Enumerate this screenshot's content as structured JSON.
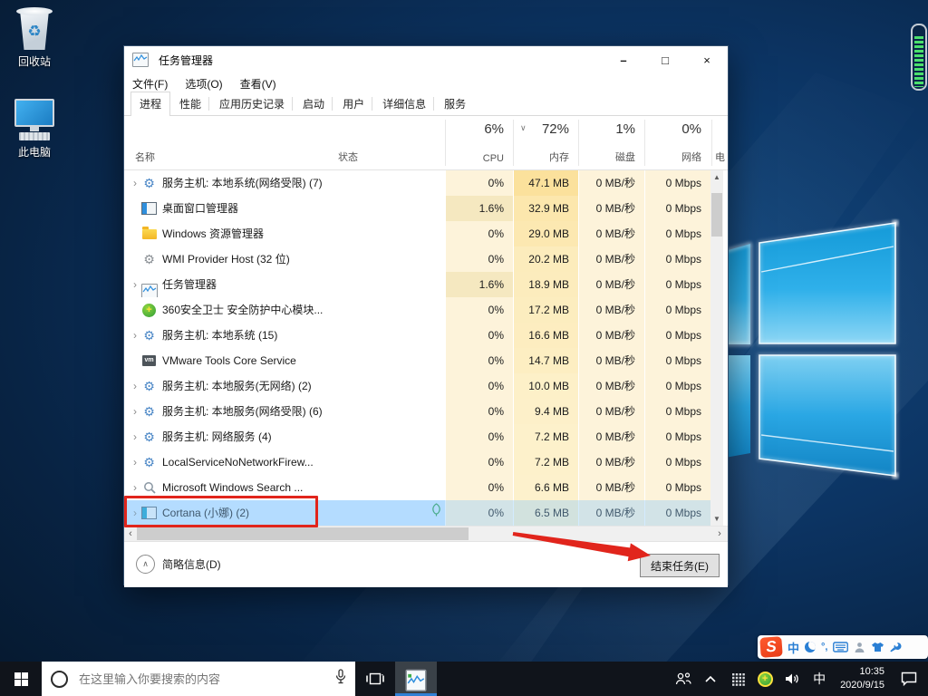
{
  "desktop": {
    "icons": [
      {
        "label": "回收站",
        "icon": "recycle-bin"
      },
      {
        "label": "此电脑",
        "icon": "this-pc"
      }
    ]
  },
  "taskmgr": {
    "title": "任务管理器",
    "menus": [
      "文件(F)",
      "选项(O)",
      "查看(V)"
    ],
    "window_controls": [
      {
        "name": "minimize",
        "glyph": "–"
      },
      {
        "name": "maximize",
        "glyph": "□"
      },
      {
        "name": "close",
        "glyph": "×"
      }
    ],
    "tabs": [
      {
        "label": "进程",
        "active": true
      },
      {
        "label": "性能",
        "active": false
      },
      {
        "label": "应用历史记录",
        "active": false
      },
      {
        "label": "启动",
        "active": false
      },
      {
        "label": "用户",
        "active": false
      },
      {
        "label": "详细信息",
        "active": false
      },
      {
        "label": "服务",
        "active": false
      }
    ],
    "columns": {
      "name": "名称",
      "status": "状态",
      "cpu": {
        "value": "6%",
        "label": "CPU"
      },
      "mem": {
        "value": "72%",
        "label": "内存",
        "sort_glyph": "∨"
      },
      "disk": {
        "value": "1%",
        "label": "磁盘"
      },
      "net": {
        "value": "0%",
        "label": "网络"
      },
      "power_clipped": "电"
    },
    "rows": [
      {
        "expand": true,
        "icon": "gear",
        "name": "服务主机: 本地系统(网络受限) (7)",
        "status": "",
        "cpu": "0%",
        "mem": "47.1 MB",
        "mem_mb": 47.1,
        "disk": "0 MB/秒",
        "net": "0 Mbps"
      },
      {
        "expand": false,
        "icon": "window",
        "name": "桌面窗口管理器",
        "status": "",
        "cpu": "1.6%",
        "mem": "32.9 MB",
        "mem_mb": 32.9,
        "disk": "0 MB/秒",
        "net": "0 Mbps"
      },
      {
        "expand": false,
        "icon": "folder",
        "name": "Windows 资源管理器",
        "status": "",
        "cpu": "0%",
        "mem": "29.0 MB",
        "mem_mb": 29.0,
        "disk": "0 MB/秒",
        "net": "0 Mbps"
      },
      {
        "expand": false,
        "icon": "wmi",
        "name": "WMI Provider Host (32 位)",
        "status": "",
        "cpu": "0%",
        "mem": "20.2 MB",
        "mem_mb": 20.2,
        "disk": "0 MB/秒",
        "net": "0 Mbps"
      },
      {
        "expand": true,
        "icon": "taskmgr",
        "name": "任务管理器",
        "status": "",
        "cpu": "1.6%",
        "mem": "18.9 MB",
        "mem_mb": 18.9,
        "disk": "0 MB/秒",
        "net": "0 Mbps"
      },
      {
        "expand": false,
        "icon": "s360",
        "name": "360安全卫士 安全防护中心模块...",
        "status": "",
        "cpu": "0%",
        "mem": "17.2 MB",
        "mem_mb": 17.2,
        "disk": "0 MB/秒",
        "net": "0 Mbps"
      },
      {
        "expand": true,
        "icon": "gear",
        "name": "服务主机: 本地系统 (15)",
        "status": "",
        "cpu": "0%",
        "mem": "16.6 MB",
        "mem_mb": 16.6,
        "disk": "0 MB/秒",
        "net": "0 Mbps"
      },
      {
        "expand": false,
        "icon": "vm",
        "name": "VMware Tools Core Service",
        "status": "",
        "cpu": "0%",
        "mem": "14.7 MB",
        "mem_mb": 14.7,
        "disk": "0 MB/秒",
        "net": "0 Mbps"
      },
      {
        "expand": true,
        "icon": "gear",
        "name": "服务主机: 本地服务(无网络) (2)",
        "status": "",
        "cpu": "0%",
        "mem": "10.0 MB",
        "mem_mb": 10.0,
        "disk": "0 MB/秒",
        "net": "0 Mbps"
      },
      {
        "expand": true,
        "icon": "gear",
        "name": "服务主机: 本地服务(网络受限) (6)",
        "status": "",
        "cpu": "0%",
        "mem": "9.4 MB",
        "mem_mb": 9.4,
        "disk": "0 MB/秒",
        "net": "0 Mbps"
      },
      {
        "expand": true,
        "icon": "gear",
        "name": "服务主机: 网络服务 (4)",
        "status": "",
        "cpu": "0%",
        "mem": "7.2 MB",
        "mem_mb": 7.2,
        "disk": "0 MB/秒",
        "net": "0 Mbps"
      },
      {
        "expand": true,
        "icon": "gear",
        "name": "LocalServiceNoNetworkFirew...",
        "status": "",
        "cpu": "0%",
        "mem": "7.2 MB",
        "mem_mb": 7.2,
        "disk": "0 MB/秒",
        "net": "0 Mbps"
      },
      {
        "expand": true,
        "icon": "search",
        "name": "Microsoft Windows Search ...",
        "status": "",
        "cpu": "0%",
        "mem": "6.6 MB",
        "mem_mb": 6.6,
        "disk": "0 MB/秒",
        "net": "0 Mbps"
      },
      {
        "expand": true,
        "icon": "cortana",
        "name": "Cortana (小娜) (2)",
        "status": "leaf",
        "cpu": "0%",
        "mem": "6.5 MB",
        "mem_mb": 6.5,
        "disk": "0 MB/秒",
        "net": "0 Mbps",
        "selected": true
      }
    ],
    "footer": {
      "collapse_label": "简略信息(D)",
      "collapse_glyph": "∧",
      "end_task_label": "结束任务(E)"
    },
    "glyphs": {
      "expand": "›",
      "vscroll_up": "▲",
      "vscroll_down": "▼",
      "hscroll_left": "‹",
      "hscroll_right": "›"
    }
  },
  "annotations": {
    "highlight_color": "#e1251c",
    "highlighted_row": "Cortana (小娜) (2)",
    "arrow_target": "结束任务(E)"
  },
  "sogou_toolbar": {
    "logo_letter": "S",
    "ime_mode": "中",
    "punct": "°,",
    "icons": [
      "sogou-logo",
      "chinese-mode",
      "moon-icon",
      "punctuation-icon",
      "keyboard-icon",
      "person-icon",
      "skin-tshirt-icon",
      "wrench-icon"
    ]
  },
  "taskbar": {
    "search_placeholder": "在这里输入你要搜索的内容",
    "ime_indicator": "中",
    "clock": {
      "time": "10:35",
      "date": "2020/9/15"
    },
    "tray_icons": [
      "people-icon",
      "hidden-icons-chevron",
      "grid-icon",
      "360-icon",
      "volume-icon"
    ]
  },
  "colors": {
    "selection_blue": "#cfe8ff",
    "taskbar_accent": "#2f80d6",
    "heat_pale": "#fdf3da",
    "heat_cpu_low": "#f5e8c0"
  }
}
